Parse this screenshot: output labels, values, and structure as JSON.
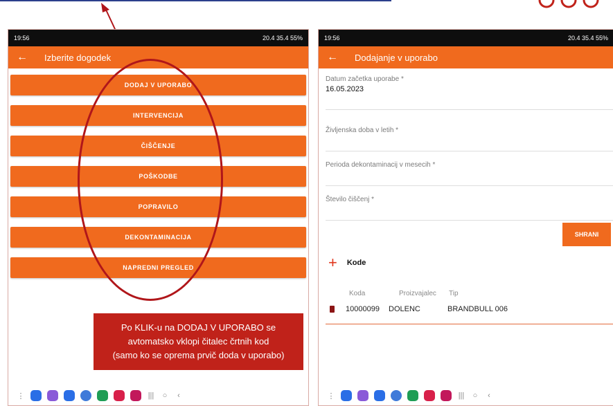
{
  "left_phone": {
    "status": {
      "time": "19:56",
      "right": "20.4 35.4 55%"
    },
    "appbar": {
      "back_icon": "arrow-left-icon",
      "title": "Izberite dogodek"
    },
    "menu": [
      "DODAJ V UPORABO",
      "INTERVENCIJA",
      "ČIŠČENJE",
      "POŠKODBE",
      "POPRAVILO",
      "DEKONTAMINACIJA",
      "NAPREDNI PREGLED"
    ]
  },
  "callout": {
    "lines": [
      "Po KLIK-u na DODAJ V UPORABO se",
      "avtomatsko vklopi čitalec črtnih kod",
      "(samo ko se oprema prvič doda v uporabo)"
    ]
  },
  "right_phone": {
    "status": {
      "time": "19:56",
      "right": "20.4 35.4 55%"
    },
    "appbar": {
      "back_icon": "arrow-left-icon",
      "title": "Dodajanje v uporabo"
    },
    "fields": [
      {
        "label": "Datum začetka uporabe *",
        "value": "16.05.2023"
      },
      {
        "label": "Življenska doba v letih *",
        "value": ""
      },
      {
        "label": "Perioda dekontaminacij v mesecih *",
        "value": ""
      },
      {
        "label": "Število čiščenj *",
        "value": ""
      }
    ],
    "save_label": "SHRANI",
    "kode_title": "Kode",
    "table": {
      "headers": [
        "Koda",
        "Proizvajalec",
        "Tip"
      ],
      "rows": [
        {
          "koda": "10000099",
          "proizvajalec": "DOLENC",
          "tip": "BRANDBULL 006"
        }
      ]
    }
  },
  "colors": {
    "accent": "#f06a1e",
    "callout": "#c0221a",
    "oval": "#b0161a"
  }
}
